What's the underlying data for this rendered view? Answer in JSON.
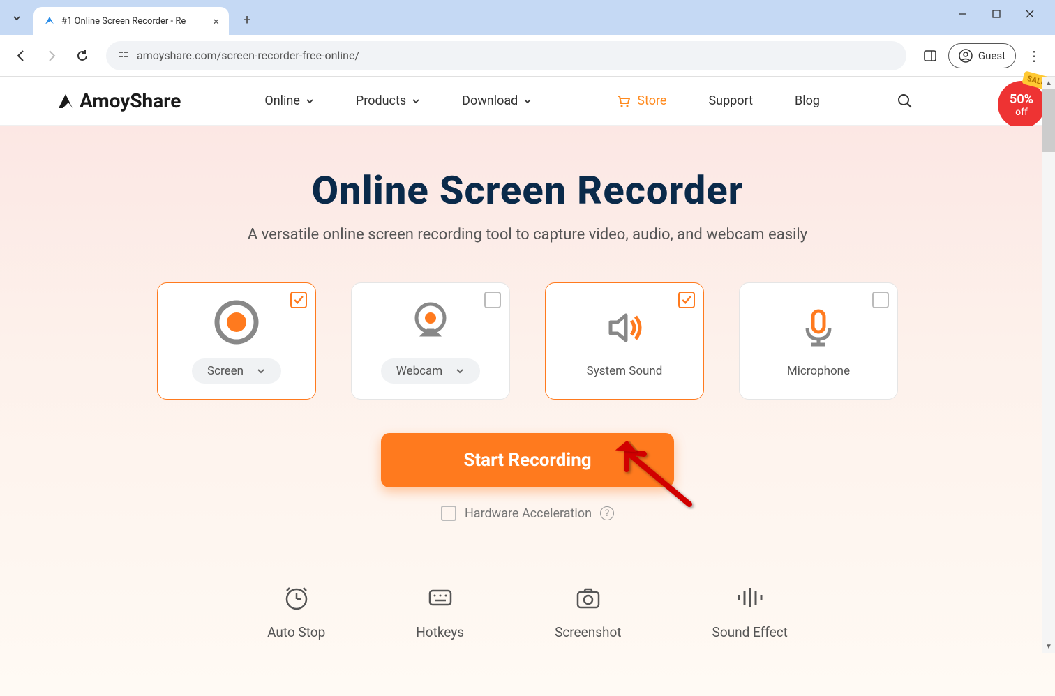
{
  "browser": {
    "tab_title": "#1 Online Screen Recorder - Re",
    "url": "amoyshare.com/screen-recorder-free-online/",
    "guest_label": "Guest"
  },
  "header": {
    "brand": "AmoyShare",
    "nav": {
      "online": "Online",
      "products": "Products",
      "download": "Download",
      "store": "Store",
      "support": "Support",
      "blog": "Blog"
    },
    "sale": {
      "tag": "SALE",
      "percent": "50%",
      "off": "off"
    }
  },
  "hero": {
    "title": "Online Screen Recorder",
    "subtitle": "A versatile online screen recording tool to capture video, audio, and webcam easily"
  },
  "cards": {
    "screen": {
      "label": "Screen",
      "selected": true
    },
    "webcam": {
      "label": "Webcam",
      "selected": false
    },
    "system_sound": {
      "label": "System Sound",
      "selected": true
    },
    "microphone": {
      "label": "Microphone",
      "selected": false
    }
  },
  "actions": {
    "start_recording": "Start Recording",
    "hw_accel": "Hardware Acceleration"
  },
  "features": {
    "auto_stop": "Auto Stop",
    "hotkeys": "Hotkeys",
    "screenshot": "Screenshot",
    "sound_effect": "Sound Effect"
  }
}
